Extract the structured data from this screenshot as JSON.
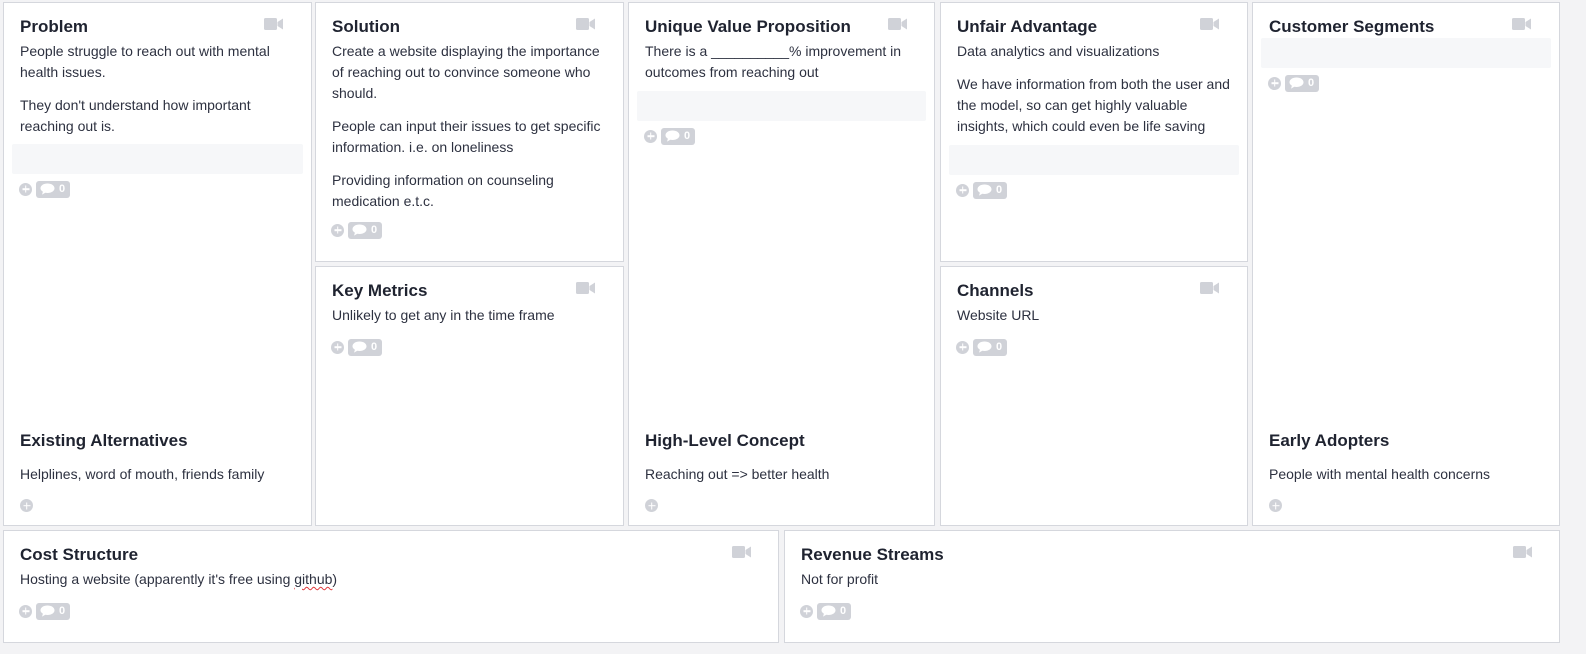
{
  "canvas": {
    "problem": {
      "title": "Problem",
      "notes": [
        "People struggle to reach out with mental health issues.",
        "They don't understand how important reaching out is."
      ],
      "comment_count": "0"
    },
    "existing_alternatives": {
      "title": "Existing Alternatives",
      "notes": [
        "Helplines, word of mouth, friends family"
      ]
    },
    "solution": {
      "title": "Solution",
      "notes": [
        "Create a website displaying the importance of reaching out to convince someone who should.",
        "People can input their issues to get specific information. i.e. on loneliness",
        "Providing information on counseling medication e.t.c."
      ],
      "comment_count": "0"
    },
    "key_metrics": {
      "title": "Key Metrics",
      "notes": [
        "Unlikely to get any in the time frame"
      ],
      "comment_count": "0"
    },
    "unique_value_proposition": {
      "title": "Unique Value Proposition",
      "notes": [
        "There is a __________% improvement in outcomes from reaching out"
      ],
      "comment_count": "0"
    },
    "high_level_concept": {
      "title": "High-Level Concept",
      "notes": [
        "Reaching out => better health"
      ]
    },
    "unfair_advantage": {
      "title": "Unfair Advantage",
      "notes": [
        "Data analytics and visualizations",
        "We have information from both the user and the model, so can get highly valuable insights, which could even be life saving"
      ],
      "comment_count": "0"
    },
    "channels": {
      "title": "Channels",
      "notes": [
        "Website URL"
      ],
      "comment_count": "0"
    },
    "customer_segments": {
      "title": "Customer Segments",
      "notes": [],
      "comment_count": "0"
    },
    "early_adopters": {
      "title": "Early Adopters",
      "notes": [
        "People with mental health concerns"
      ]
    },
    "cost_structure": {
      "title": "Cost Structure",
      "note_before": "Hosting a website (apparently it's free using ",
      "note_flagged": "github",
      "note_after": ")",
      "comment_count": "0"
    },
    "revenue_streams": {
      "title": "Revenue Streams",
      "notes": [
        "Not for profit"
      ],
      "comment_count": "0"
    }
  },
  "icons": {
    "video": "video-camera-icon",
    "add": "add-circle-icon",
    "comment": "speech-bubble-icon"
  },
  "colors": {
    "icon_gray": "#d0d2d8",
    "card_border": "#d5d7dd",
    "background": "#f3f3f5"
  }
}
